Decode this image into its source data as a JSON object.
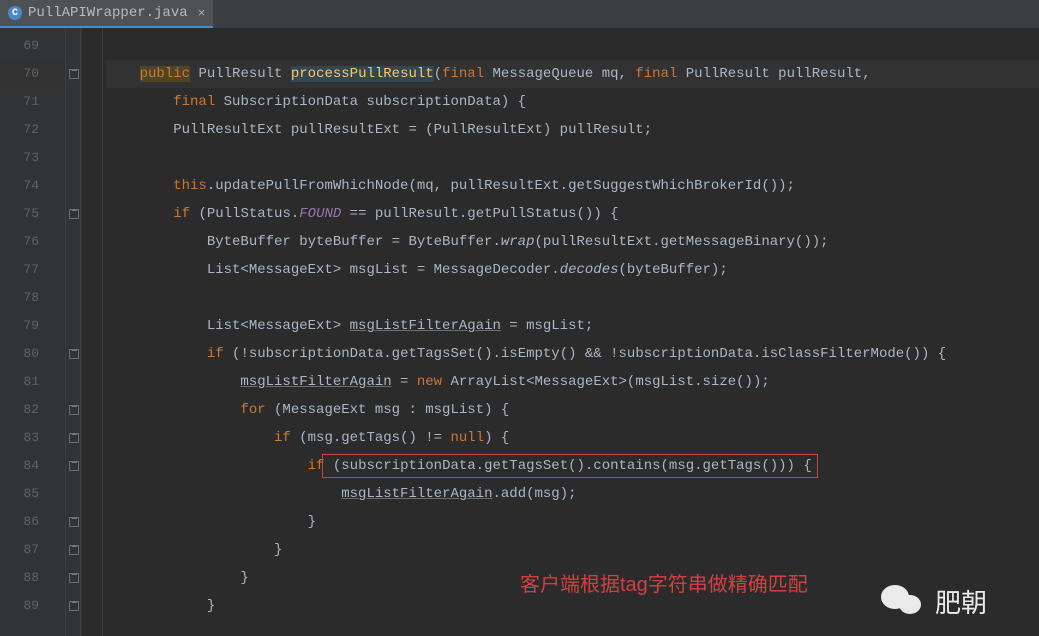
{
  "tab": {
    "filename": "PullAPIWrapper.java",
    "icon_letter": "C"
  },
  "gutter": {
    "start": 69,
    "end": 89
  },
  "caret_line": 70,
  "code_lines": [
    {
      "n": 69,
      "indent": 0,
      "tokens": []
    },
    {
      "n": 70,
      "indent": 1,
      "tokens": [
        {
          "t": "public",
          "c": "kw-hl"
        },
        {
          "t": " "
        },
        {
          "t": "PullResult",
          "c": "type"
        },
        {
          "t": " "
        },
        {
          "t": "processPullResult",
          "c": "method-decl-hl"
        },
        {
          "t": "(",
          "c": "paren"
        },
        {
          "t": "final",
          "c": "kw"
        },
        {
          "t": " MessageQueue mq"
        },
        {
          "t": ", "
        },
        {
          "t": "final",
          "c": "kw"
        },
        {
          "t": " PullResult pullResult"
        },
        {
          "t": ","
        }
      ]
    },
    {
      "n": 71,
      "indent": 2,
      "tokens": [
        {
          "t": "final",
          "c": "kw"
        },
        {
          "t": " SubscriptionData subscriptionData) {"
        }
      ]
    },
    {
      "n": 72,
      "indent": 2,
      "tokens": [
        {
          "t": "PullResultExt pullResultExt = (PullResultExt) pullResult;"
        }
      ]
    },
    {
      "n": 73,
      "indent": 0,
      "tokens": []
    },
    {
      "n": 74,
      "indent": 2,
      "tokens": [
        {
          "t": "this",
          "c": "kw"
        },
        {
          "t": ".updatePullFromWhichNode(mq"
        },
        {
          "t": ", "
        },
        {
          "t": "pullResultExt.getSuggestWhichBrokerId());"
        }
      ]
    },
    {
      "n": 75,
      "indent": 2,
      "tokens": [
        {
          "t": "if ",
          "c": "kw"
        },
        {
          "t": "(PullStatus."
        },
        {
          "t": "FOUND",
          "c": "static-it"
        },
        {
          "t": " == pullResult.getPullStatus()) {"
        }
      ]
    },
    {
      "n": 76,
      "indent": 3,
      "tokens": [
        {
          "t": "ByteBuffer byteBuffer = ByteBuffer."
        },
        {
          "t": "wrap",
          "c": "static-method"
        },
        {
          "t": "(pullResultExt.getMessageBinary());"
        }
      ]
    },
    {
      "n": 77,
      "indent": 3,
      "tokens": [
        {
          "t": "List<MessageExt> msgList = MessageDecoder."
        },
        {
          "t": "decodes",
          "c": "static-method"
        },
        {
          "t": "(byteBuffer);"
        }
      ]
    },
    {
      "n": 78,
      "indent": 0,
      "tokens": []
    },
    {
      "n": 79,
      "indent": 3,
      "tokens": [
        {
          "t": "List<MessageExt> "
        },
        {
          "t": "msgListFilterAgain",
          "c": "underline"
        },
        {
          "t": " = msgList;"
        }
      ]
    },
    {
      "n": 80,
      "indent": 3,
      "tokens": [
        {
          "t": "if ",
          "c": "kw"
        },
        {
          "t": "(!subscriptionData.getTagsSet().isEmpty() && !subscriptionData.isClassFilterMode()) {"
        }
      ]
    },
    {
      "n": 81,
      "indent": 4,
      "tokens": [
        {
          "t": "msgListFilterAgain",
          "c": "underline"
        },
        {
          "t": " = "
        },
        {
          "t": "new",
          "c": "kw"
        },
        {
          "t": " ArrayList<MessageExt>(msgList.size());"
        }
      ]
    },
    {
      "n": 82,
      "indent": 4,
      "tokens": [
        {
          "t": "for ",
          "c": "kw"
        },
        {
          "t": "(MessageExt msg : msgList) {"
        }
      ]
    },
    {
      "n": 83,
      "indent": 5,
      "tokens": [
        {
          "t": "if ",
          "c": "kw"
        },
        {
          "t": "(msg.getTags() != "
        },
        {
          "t": "null",
          "c": "kw"
        },
        {
          "t": ") {"
        }
      ]
    },
    {
      "n": 84,
      "indent": 6,
      "tokens": [
        {
          "t": "if ",
          "c": "kw"
        },
        {
          "t": "(subscriptionData.getTagsSet().contains(msg.getTags()))"
        },
        {
          "t": " {"
        }
      ]
    },
    {
      "n": 85,
      "indent": 7,
      "tokens": [
        {
          "t": "msgListFilterAgain",
          "c": "underline"
        },
        {
          "t": ".add(msg);"
        }
      ]
    },
    {
      "n": 86,
      "indent": 6,
      "tokens": [
        {
          "t": "}"
        }
      ]
    },
    {
      "n": 87,
      "indent": 5,
      "tokens": [
        {
          "t": "}"
        }
      ]
    },
    {
      "n": 88,
      "indent": 4,
      "tokens": [
        {
          "t": "}"
        }
      ]
    },
    {
      "n": 89,
      "indent": 3,
      "tokens": [
        {
          "t": "}"
        }
      ]
    }
  ],
  "redbox": {
    "line": 84,
    "text_segment": "if (subscriptionData.getTagsSet().contains(msg.getTags()))"
  },
  "annotation": {
    "text": "客户端根据tag字符串做精确匹配"
  },
  "watermark": {
    "text": "肥朝"
  },
  "fold_markers_at": [
    70,
    75,
    80,
    82,
    83,
    84,
    86,
    87,
    88,
    89
  ]
}
